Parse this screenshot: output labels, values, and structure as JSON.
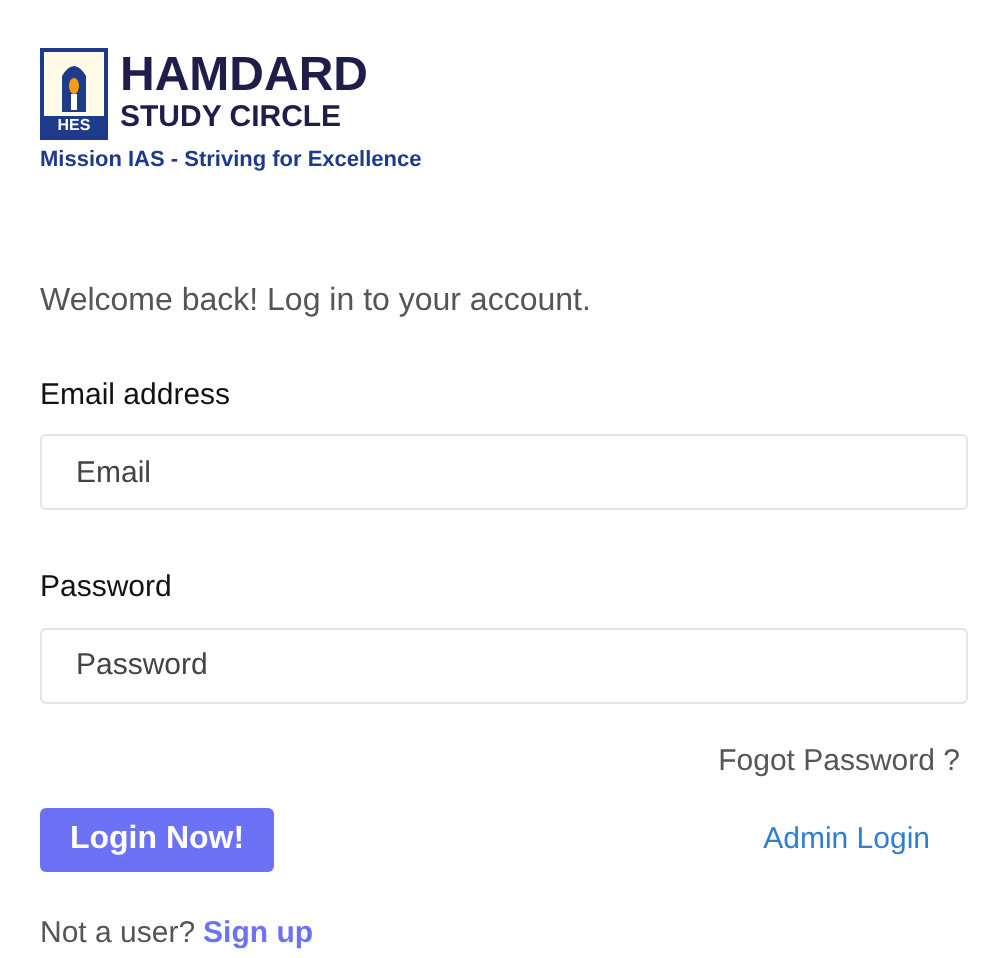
{
  "logo": {
    "mark": "HES",
    "title": "HAMDARD",
    "subtitle": "STUDY CIRCLE",
    "tagline": "Mission IAS - Striving for Excellence"
  },
  "welcome": "Welcome back! Log in to your account.",
  "fields": [
    {
      "label": "Email address",
      "placeholder": "Email"
    },
    {
      "label": "Password",
      "placeholder": "Password"
    }
  ],
  "forgot_link": "Fogot Password ?",
  "login_button": "Login Now!",
  "admin_link": "Admin Login",
  "signup": {
    "prompt": "Not a user?",
    "link": "Sign up"
  }
}
